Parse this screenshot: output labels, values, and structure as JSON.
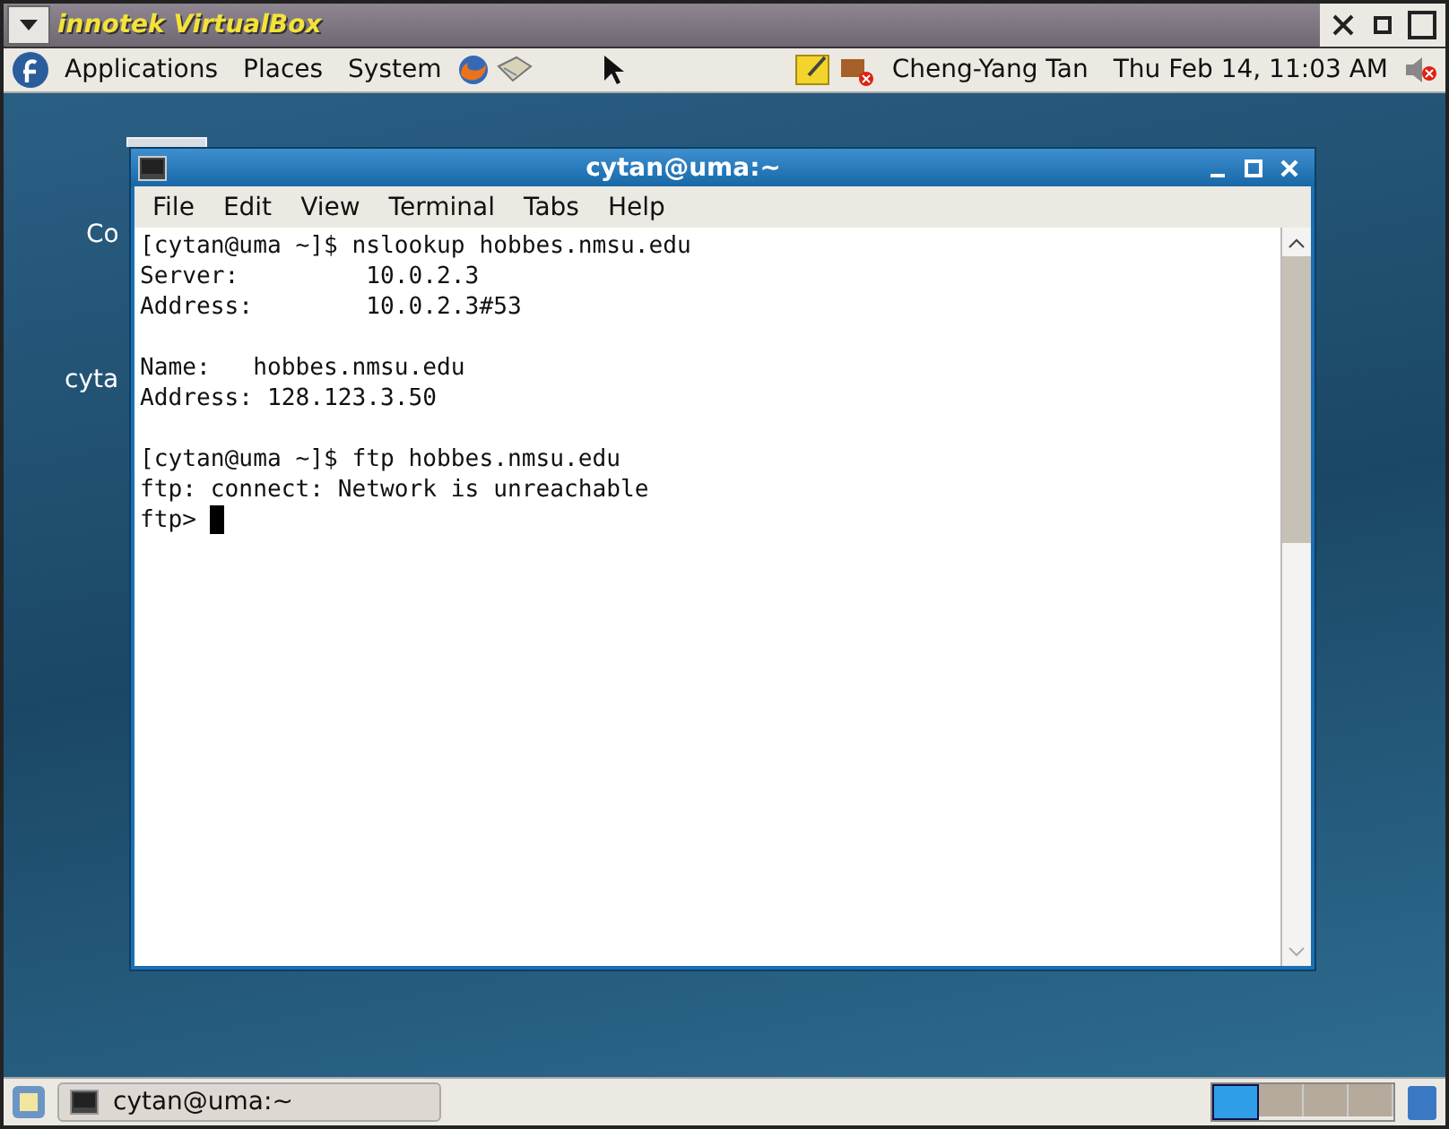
{
  "host_window": {
    "title": "innotek VirtualBox"
  },
  "top_panel": {
    "menus": [
      "Applications",
      "Places",
      "System"
    ],
    "user": "Cheng-Yang Tan",
    "clock": "Thu Feb 14, 11:03 AM"
  },
  "desktop_icons": [
    {
      "label": "Co"
    },
    {
      "label": "cyta"
    }
  ],
  "terminal": {
    "title": "cytan@uma:~",
    "menu": [
      "File",
      "Edit",
      "View",
      "Terminal",
      "Tabs",
      "Help"
    ],
    "lines": [
      {
        "kind": "text",
        "text": "[cytan@uma ~]$ nslookup hobbes.nmsu.edu",
        "cursor": false
      },
      {
        "kind": "text",
        "text": "Server:         10.0.2.3",
        "cursor": false
      },
      {
        "kind": "text",
        "text": "Address:        10.0.2.3#53",
        "cursor": false
      },
      {
        "kind": "blank"
      },
      {
        "kind": "text",
        "text": "Name:   hobbes.nmsu.edu",
        "cursor": false
      },
      {
        "kind": "text",
        "text": "Address: 128.123.3.50",
        "cursor": false
      },
      {
        "kind": "blank"
      },
      {
        "kind": "text",
        "text": "[cytan@uma ~]$ ftp hobbes.nmsu.edu",
        "cursor": false
      },
      {
        "kind": "text",
        "text": "ftp: connect: Network is unreachable",
        "cursor": false
      },
      {
        "kind": "text",
        "text": "ftp> ",
        "cursor": true
      }
    ]
  },
  "bottom_panel": {
    "tasks": [
      {
        "label": "cytan@uma:~",
        "selected": false
      }
    ],
    "workspaces": [
      {
        "selected": true
      },
      {
        "selected": false
      },
      {
        "selected": false
      },
      {
        "selected": false
      }
    ]
  }
}
